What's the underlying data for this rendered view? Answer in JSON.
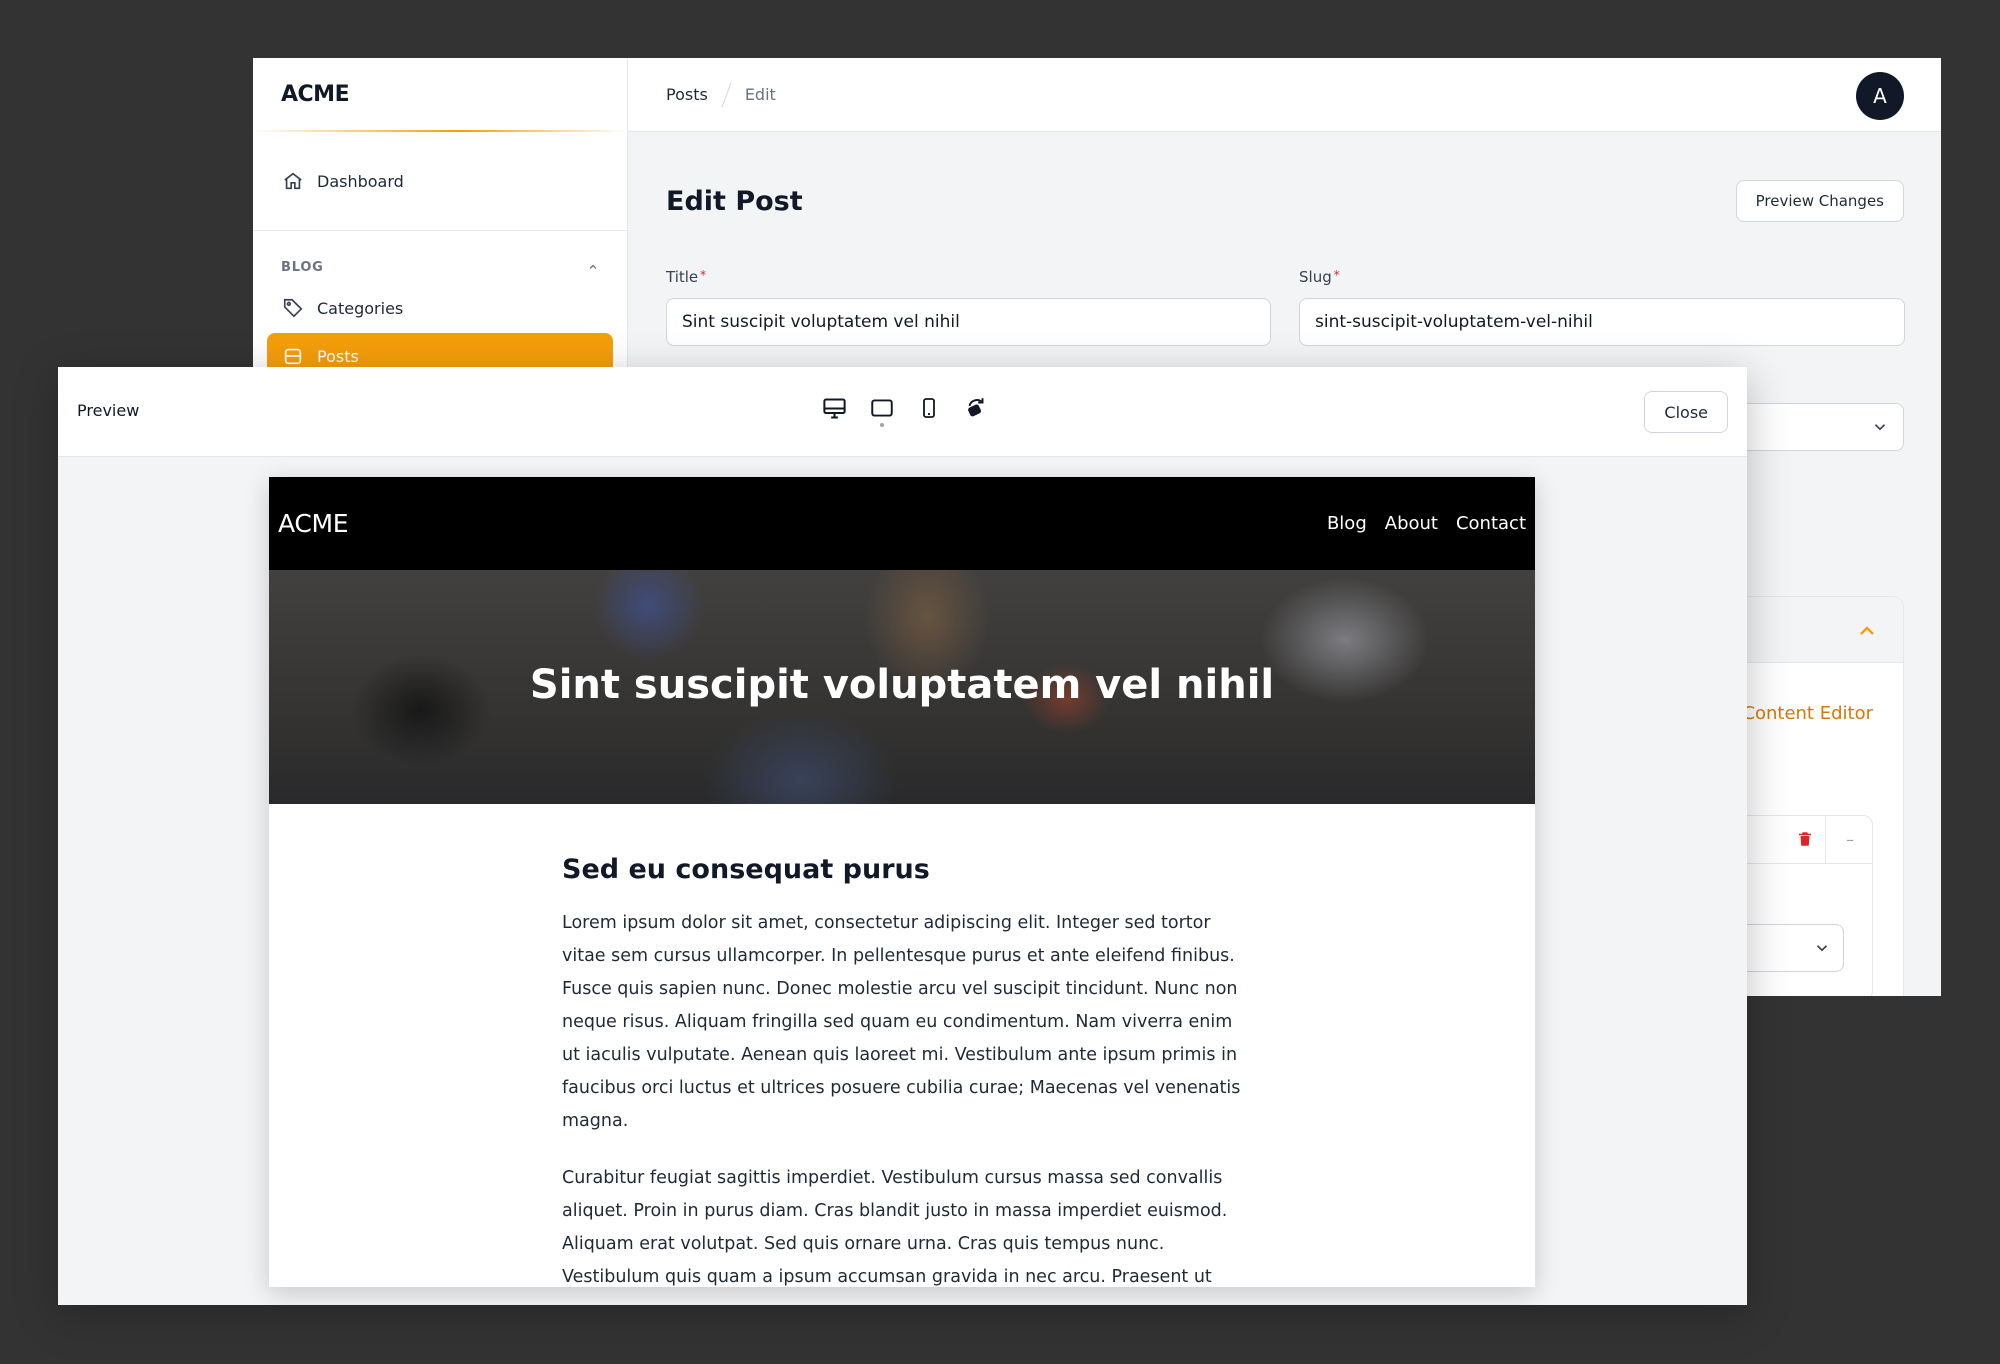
{
  "admin": {
    "brand": "ACME",
    "sidebar": {
      "dashboard": "Dashboard",
      "group_label": "BLOG",
      "categories": "Categories",
      "posts": "Posts"
    },
    "breadcrumb": {
      "posts": "Posts",
      "edit": "Edit"
    },
    "avatar_initial": "A",
    "page_title": "Edit Post",
    "preview_changes": "Preview Changes",
    "form": {
      "title_label": "Title",
      "title_value": "Sint suscipit voluptatem vel nihil",
      "slug_label": "Slug",
      "slug_value": "sint-suscipit-voluptatem-vel-nihil",
      "required_mark": "*"
    },
    "content_editor_tab": "Content Editor",
    "collapse_symbol": "–"
  },
  "preview": {
    "title": "Preview",
    "close": "Close",
    "devices": [
      "desktop-icon",
      "tablet-icon",
      "mobile-icon",
      "rotate-icon"
    ],
    "site": {
      "brand": "ACME",
      "nav": [
        "Blog",
        "About",
        "Contact"
      ],
      "hero_title": "Sint suscipit voluptatem vel nihil",
      "heading": "Sed eu consequat purus",
      "paragraphs": [
        "Lorem ipsum dolor sit amet, consectetur adipiscing elit. Integer sed tortor vitae sem cursus ullamcorper. In pellentesque purus et ante eleifend finibus. Fusce quis sapien nunc. Donec molestie arcu vel suscipit tincidunt. Nunc non neque risus. Aliquam fringilla sed quam eu condimentum. Nam viverra enim ut iaculis vulputate. Aenean quis laoreet mi. Vestibulum ante ipsum primis in faucibus orci luctus et ultrices posuere cubilia curae; Maecenas vel venenatis magna.",
        "Curabitur feugiat sagittis imperdiet. Vestibulum cursus massa sed convallis aliquet. Proin in purus diam. Cras blandit justo in massa imperdiet euismod. Aliquam erat volutpat. Sed quis ornare urna. Cras quis tempus nunc. Vestibulum quis quam a ipsum accumsan gravida in nec arcu. Praesent ut eros eros. Proin vel bibendum eros. In egestas suscipit purus vel efficitur. Proin at elit risus."
      ]
    }
  },
  "colors": {
    "accent": "#f59e0b",
    "accent_text": "#d97706",
    "danger": "#dc2626",
    "dark": "#111827"
  }
}
